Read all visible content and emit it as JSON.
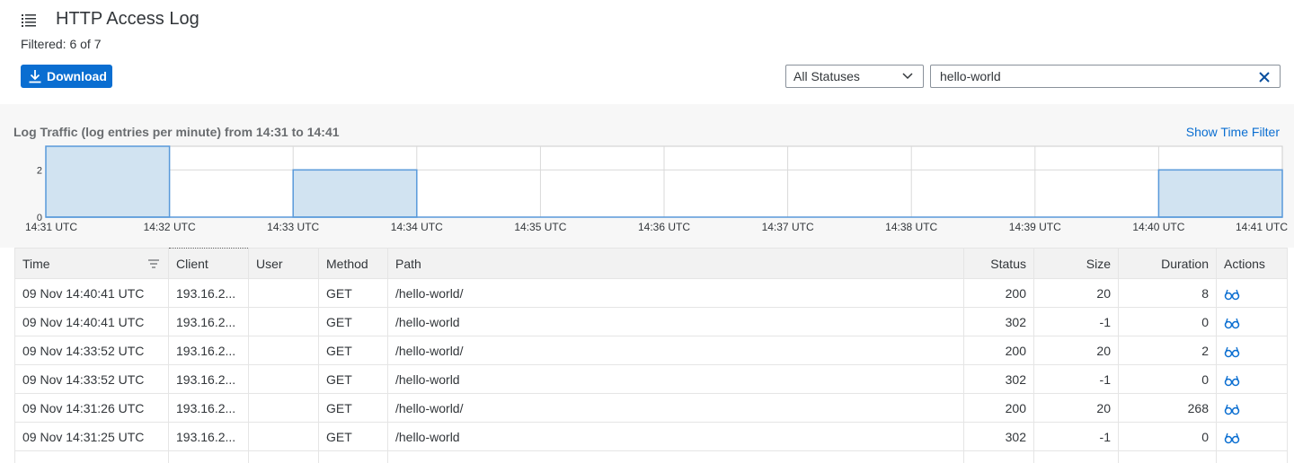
{
  "header": {
    "title": "HTTP Access Log",
    "filtered_text": "Filtered: 6 of 7",
    "download_label": "Download"
  },
  "filters": {
    "status_selected": "All Statuses",
    "search_value": "hello-world"
  },
  "chart_section": {
    "show_time_filter_label": "Show Time Filter"
  },
  "colors": {
    "accent": "#0a6ed1",
    "bar_fill": "#d1e3f1",
    "bar_stroke": "#5899da"
  },
  "chart_data": {
    "type": "area",
    "title": "Log Traffic (log entries per minute) from 14:31 to 14:41",
    "categories": [
      "14:31 UTC",
      "14:32 UTC",
      "14:33 UTC",
      "14:34 UTC",
      "14:35 UTC",
      "14:36 UTC",
      "14:37 UTC",
      "14:38 UTC",
      "14:39 UTC",
      "14:40 UTC",
      "14:41 UTC"
    ],
    "values": [
      3,
      0,
      2,
      0,
      0,
      0,
      0,
      0,
      0,
      2
    ],
    "y_ticks": [
      "0",
      "2"
    ],
    "ylim": [
      0,
      3
    ],
    "grid": true
  },
  "table": {
    "columns": [
      {
        "key": "time",
        "label": "Time"
      },
      {
        "key": "client",
        "label": "Client"
      },
      {
        "key": "user",
        "label": "User"
      },
      {
        "key": "method",
        "label": "Method"
      },
      {
        "key": "path",
        "label": "Path"
      },
      {
        "key": "status",
        "label": "Status"
      },
      {
        "key": "size",
        "label": "Size"
      },
      {
        "key": "duration",
        "label": "Duration"
      },
      {
        "key": "actions",
        "label": "Actions"
      }
    ],
    "rows": [
      {
        "time": "09 Nov 14:40:41 UTC",
        "client": "193.16.2...",
        "user": "",
        "method": "GET",
        "path": "/hello-world/",
        "status": "200",
        "size": "20",
        "duration": "8",
        "action_icon": "glasses-icon"
      },
      {
        "time": "09 Nov 14:40:41 UTC",
        "client": "193.16.2...",
        "user": "",
        "method": "GET",
        "path": "/hello-world",
        "status": "302",
        "size": "-1",
        "duration": "0",
        "action_icon": "glasses-icon"
      },
      {
        "time": "09 Nov 14:33:52 UTC",
        "client": "193.16.2...",
        "user": "",
        "method": "GET",
        "path": "/hello-world/",
        "status": "200",
        "size": "20",
        "duration": "2",
        "action_icon": "glasses-icon"
      },
      {
        "time": "09 Nov 14:33:52 UTC",
        "client": "193.16.2...",
        "user": "",
        "method": "GET",
        "path": "/hello-world",
        "status": "302",
        "size": "-1",
        "duration": "0",
        "action_icon": "glasses-icon"
      },
      {
        "time": "09 Nov 14:31:26 UTC",
        "client": "193.16.2...",
        "user": "",
        "method": "GET",
        "path": "/hello-world/",
        "status": "200",
        "size": "20",
        "duration": "268",
        "action_icon": "glasses-icon"
      },
      {
        "time": "09 Nov 14:31:25 UTC",
        "client": "193.16.2...",
        "user": "",
        "method": "GET",
        "path": "/hello-world",
        "status": "302",
        "size": "-1",
        "duration": "0",
        "action_icon": "glasses-icon"
      }
    ]
  }
}
